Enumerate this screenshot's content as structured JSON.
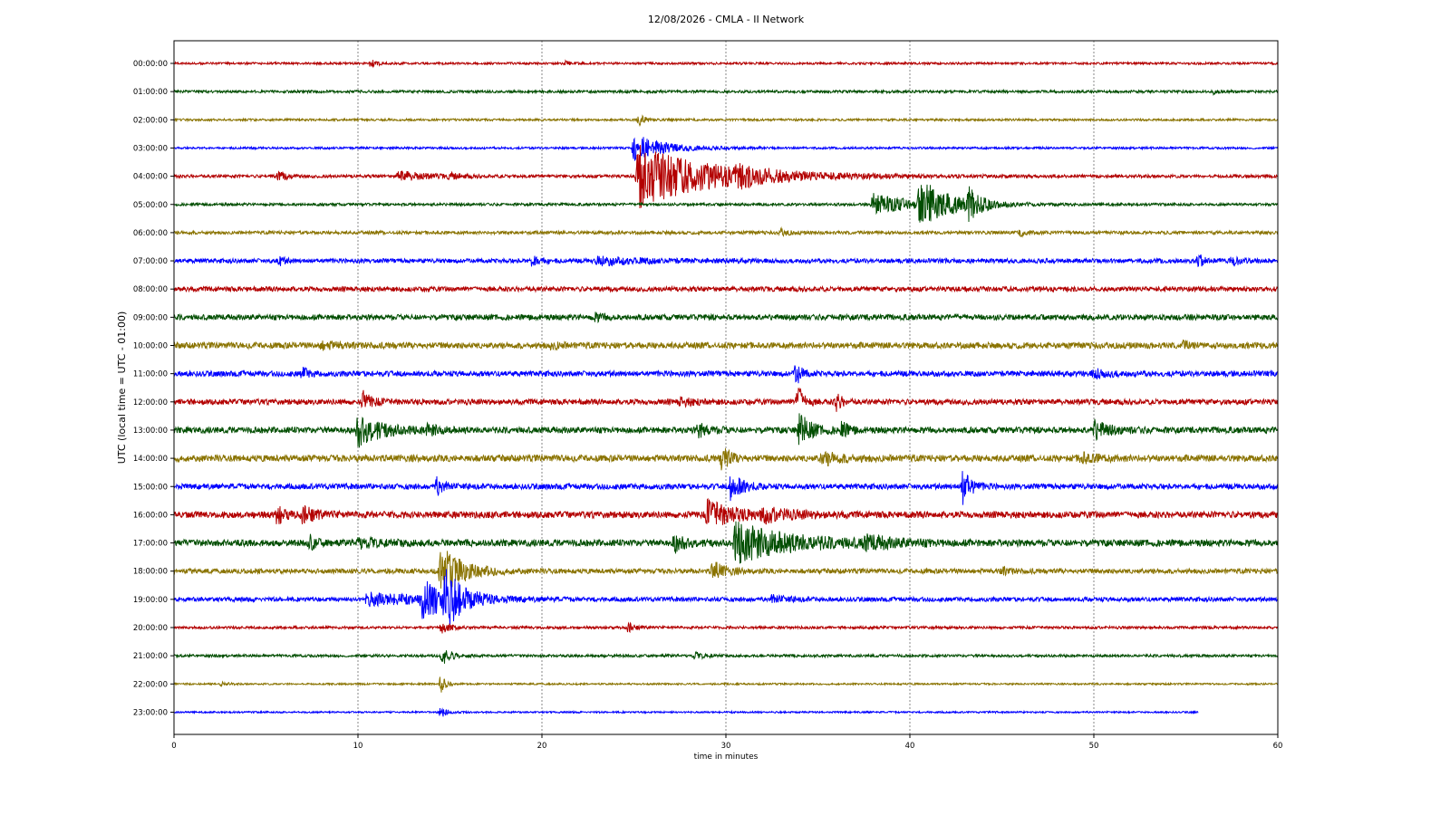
{
  "chart_data": {
    "type": "line",
    "title": "12/08/2026 - CMLA - II Network",
    "xlabel": "time in minutes",
    "ylabel": "UTC (local time = UTC - 01:00)",
    "xlim": [
      0,
      60
    ],
    "x_ticks": [
      "0",
      "10",
      "20",
      "30",
      "40",
      "50",
      "60"
    ],
    "grid": "vertical dashed at x ticks",
    "row_colors": [
      "#b30000",
      "#004d00",
      "#8a7300",
      "#0000ff"
    ],
    "rows": [
      {
        "label": "00:00:00",
        "noise": 0.1,
        "end": 60,
        "events": [
          {
            "t": 10.7,
            "a": 0.35,
            "w": 0.3
          },
          {
            "t": 21.3,
            "a": 0.2,
            "w": 0.3
          }
        ]
      },
      {
        "label": "01:00:00",
        "noise": 0.12,
        "end": 60,
        "events": [
          {
            "t": 56.5,
            "a": 0.15,
            "w": 0.3
          }
        ]
      },
      {
        "label": "02:00:00",
        "noise": 0.1,
        "end": 60,
        "events": [
          {
            "t": 25.3,
            "a": 0.5,
            "w": 0.3
          }
        ]
      },
      {
        "label": "03:00:00",
        "noise": 0.1,
        "end": 60,
        "events": [
          {
            "t": 25.0,
            "a": 1.3,
            "w": 1.5
          }
        ]
      },
      {
        "label": "04:00:00",
        "noise": 0.14,
        "end": 60,
        "events": [
          {
            "t": 5.7,
            "a": 0.5,
            "w": 0.4
          },
          {
            "t": 12.2,
            "a": 0.45,
            "w": 1.5
          },
          {
            "t": 15.0,
            "a": 0.2,
            "w": 0.6
          },
          {
            "t": 25.2,
            "a": 2.9,
            "w": 4.0
          },
          {
            "t": 30.5,
            "a": 0.5,
            "w": 1.5
          }
        ]
      },
      {
        "label": "05:00:00",
        "noise": 0.12,
        "end": 60,
        "events": [
          {
            "t": 38.0,
            "a": 1.0,
            "w": 2.0
          },
          {
            "t": 40.5,
            "a": 2.2,
            "w": 1.5
          },
          {
            "t": 43.2,
            "a": 1.2,
            "w": 0.6
          }
        ]
      },
      {
        "label": "06:00:00",
        "noise": 0.15,
        "end": 60,
        "events": [
          {
            "t": 33.0,
            "a": 0.3,
            "w": 0.4
          },
          {
            "t": 46.0,
            "a": 0.25,
            "w": 0.5
          }
        ]
      },
      {
        "label": "07:00:00",
        "noise": 0.2,
        "end": 60,
        "events": [
          {
            "t": 5.7,
            "a": 0.4,
            "w": 0.3
          },
          {
            "t": 19.5,
            "a": 0.6,
            "w": 0.4
          },
          {
            "t": 23.0,
            "a": 0.35,
            "w": 2.5
          },
          {
            "t": 55.7,
            "a": 0.6,
            "w": 0.3
          },
          {
            "t": 57.5,
            "a": 0.6,
            "w": 0.3
          }
        ]
      },
      {
        "label": "08:00:00",
        "noise": 0.22,
        "end": 60,
        "events": []
      },
      {
        "label": "09:00:00",
        "noise": 0.25,
        "end": 60,
        "events": [
          {
            "t": 22.8,
            "a": 0.3,
            "w": 0.6
          }
        ]
      },
      {
        "label": "10:00:00",
        "noise": 0.28,
        "end": 60,
        "events": [
          {
            "t": 8.0,
            "a": 0.25,
            "w": 1.0
          },
          {
            "t": 20.5,
            "a": 0.25,
            "w": 0.5
          },
          {
            "t": 54.8,
            "a": 0.3,
            "w": 0.4
          }
        ]
      },
      {
        "label": "11:00:00",
        "noise": 0.25,
        "end": 60,
        "events": [
          {
            "t": 7.0,
            "a": 0.5,
            "w": 0.3
          },
          {
            "t": 33.8,
            "a": 1.0,
            "w": 0.3
          },
          {
            "t": 50.0,
            "a": 0.35,
            "w": 0.8
          }
        ]
      },
      {
        "label": "12:00:00",
        "noise": 0.25,
        "end": 60,
        "events": [
          {
            "t": 10.3,
            "a": 0.9,
            "w": 0.4
          },
          {
            "t": 33.9,
            "a": 1.8,
            "w": 0.3
          },
          {
            "t": 36.0,
            "a": 0.8,
            "w": 0.3
          },
          {
            "t": 27.5,
            "a": 0.3,
            "w": 0.8
          }
        ]
      },
      {
        "label": "13:00:00",
        "noise": 0.28,
        "end": 60,
        "events": [
          {
            "t": 10.0,
            "a": 1.5,
            "w": 1.2
          },
          {
            "t": 13.8,
            "a": 0.4,
            "w": 0.6
          },
          {
            "t": 28.5,
            "a": 0.6,
            "w": 0.6
          },
          {
            "t": 34.0,
            "a": 1.5,
            "w": 0.6
          },
          {
            "t": 36.2,
            "a": 0.8,
            "w": 0.4
          },
          {
            "t": 50.0,
            "a": 0.8,
            "w": 0.8
          }
        ]
      },
      {
        "label": "14:00:00",
        "noise": 0.3,
        "end": 60,
        "events": [
          {
            "t": 29.8,
            "a": 1.2,
            "w": 0.4
          },
          {
            "t": 35.2,
            "a": 0.6,
            "w": 1.0
          },
          {
            "t": 49.3,
            "a": 0.5,
            "w": 0.8
          }
        ]
      },
      {
        "label": "15:00:00",
        "noise": 0.25,
        "end": 60,
        "events": [
          {
            "t": 14.3,
            "a": 0.8,
            "w": 0.4
          },
          {
            "t": 30.3,
            "a": 1.8,
            "w": 0.5
          },
          {
            "t": 42.9,
            "a": 1.8,
            "w": 0.4
          }
        ]
      },
      {
        "label": "16:00:00",
        "noise": 0.3,
        "end": 60,
        "events": [
          {
            "t": 5.6,
            "a": 0.8,
            "w": 0.4
          },
          {
            "t": 7.0,
            "a": 0.7,
            "w": 0.7
          },
          {
            "t": 29.0,
            "a": 1.2,
            "w": 1.5
          },
          {
            "t": 32.0,
            "a": 0.5,
            "w": 1.5
          }
        ]
      },
      {
        "label": "17:00:00",
        "noise": 0.3,
        "end": 60,
        "events": [
          {
            "t": 7.4,
            "a": 0.6,
            "w": 0.3
          },
          {
            "t": 10.0,
            "a": 0.4,
            "w": 1.5
          },
          {
            "t": 27.2,
            "a": 0.8,
            "w": 0.6
          },
          {
            "t": 30.5,
            "a": 1.8,
            "w": 3.0
          },
          {
            "t": 37.5,
            "a": 0.5,
            "w": 1.5
          }
        ]
      },
      {
        "label": "18:00:00",
        "noise": 0.22,
        "end": 60,
        "events": [
          {
            "t": 14.5,
            "a": 2.2,
            "w": 1.2
          },
          {
            "t": 29.3,
            "a": 0.9,
            "w": 0.6
          },
          {
            "t": 45.0,
            "a": 0.3,
            "w": 0.5
          }
        ]
      },
      {
        "label": "19:00:00",
        "noise": 0.2,
        "end": 60,
        "events": [
          {
            "t": 10.5,
            "a": 0.6,
            "w": 3.0
          },
          {
            "t": 13.5,
            "a": 1.6,
            "w": 1.5
          },
          {
            "t": 14.7,
            "a": 2.3,
            "w": 0.8
          },
          {
            "t": 32.5,
            "a": 0.35,
            "w": 0.8
          }
        ]
      },
      {
        "label": "20:00:00",
        "noise": 0.12,
        "end": 60,
        "events": [
          {
            "t": 24.7,
            "a": 0.45,
            "w": 0.3
          },
          {
            "t": 14.5,
            "a": 0.5,
            "w": 0.5
          }
        ]
      },
      {
        "label": "21:00:00",
        "noise": 0.12,
        "end": 60,
        "events": [
          {
            "t": 14.6,
            "a": 1.0,
            "w": 0.4
          },
          {
            "t": 28.3,
            "a": 0.3,
            "w": 0.6
          }
        ]
      },
      {
        "label": "22:00:00",
        "noise": 0.08,
        "end": 60,
        "events": [
          {
            "t": 14.5,
            "a": 0.8,
            "w": 0.3
          },
          {
            "t": 2.6,
            "a": 0.2,
            "w": 0.3
          }
        ]
      },
      {
        "label": "23:00:00",
        "noise": 0.08,
        "end": 55.7,
        "events": [
          {
            "t": 14.5,
            "a": 0.6,
            "w": 0.3
          }
        ]
      }
    ]
  }
}
